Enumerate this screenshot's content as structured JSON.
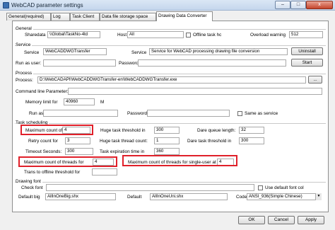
{
  "window": {
    "title": "WebCAD parameter settings",
    "minimize_glyph": "–",
    "maximize_glyph": "□",
    "close_glyph": "x"
  },
  "tabs": [
    {
      "label": "General(required)"
    },
    {
      "label": "Log"
    },
    {
      "label": "Task Client"
    },
    {
      "label": "Data file storage space"
    },
    {
      "label": "Drawing Data Converter"
    }
  ],
  "general": {
    "heading": "General",
    "sharedata_label": "Sharedata",
    "sharedata_value": "\\\\Global\\TaskNo-4ld",
    "host_label": "Host",
    "host_value": "All",
    "offline_task_label": "Offline task hc",
    "overload_label": "Overload warning",
    "overload_value": "512"
  },
  "service": {
    "heading": "Service",
    "service_label": "Service",
    "service_value": "WebCADDWGTransfer",
    "service_desc_label": "Service",
    "service_desc_value": "Service for WebCAD processing drawing file conversion",
    "uninstall_label": "Uninstall",
    "run_as_label": "Run as user:",
    "run_as_value": "",
    "password_label": "Password:",
    "password_value": "",
    "start_label": "Start"
  },
  "process": {
    "heading": "Process",
    "process_label": "Process:",
    "process_value": "D:\\WebCADAPI\\WebCADDWGTransfer-en\\WebCADDWGTransfer.exe",
    "browse_label": "...",
    "cmdline_label": "Command line Parameter:",
    "cmdline_value": "",
    "memory_label": "Memory limit for",
    "memory_value": "40960",
    "memory_unit": "M",
    "run_as_label": "Run as",
    "run_as_value": "",
    "password_label": "Password:",
    "password_value": "",
    "same_as_service_label": "Same as service"
  },
  "scheduling": {
    "heading": "Task scheduling",
    "max_count_label": "Maximum count of",
    "max_count_value": "4",
    "huge_threshold_label": "Huge task threshold in",
    "huge_threshold_value": "300",
    "dare_queue_label": "Dare queue length:",
    "dare_queue_value": "32",
    "retry_label": "Retry count for",
    "retry_value": "3",
    "huge_thread_label": "Huge task thread count:",
    "huge_thread_value": "1",
    "dare_threshold_label": "Dare task threshold in",
    "dare_threshold_value": "300",
    "timeout_label": "Timeout Seconds:",
    "timeout_value": "300",
    "expiration_label": "Task expiration time in",
    "expiration_value": "360",
    "max_threads_label": "Maximum count of threads for",
    "max_threads_value": "4",
    "single_user_label": "Maximum count of threads for single-user at",
    "single_user_value": "4",
    "trans_offline_label": "Trans to offline threshold for",
    "trans_offline_value": ""
  },
  "drawing_font": {
    "heading": "Drawing font",
    "check_font_label": "Check font",
    "check_font_value": "",
    "use_default_label": "Use default font col",
    "default_big_label": "Default big",
    "default_big_value": "AllInOneBig.shx",
    "default_label": "Default",
    "default_value": "AllInOneUni.shx",
    "code_label": "Code",
    "code_value": "ANSI_936(Simple Chinese)"
  },
  "footer": {
    "ok_label": "OK",
    "cancel_label": "Cancel",
    "apply_label": "Apply"
  },
  "colors": {
    "highlight_box": "#e0202a",
    "title_bar": "#c4d6ec"
  }
}
